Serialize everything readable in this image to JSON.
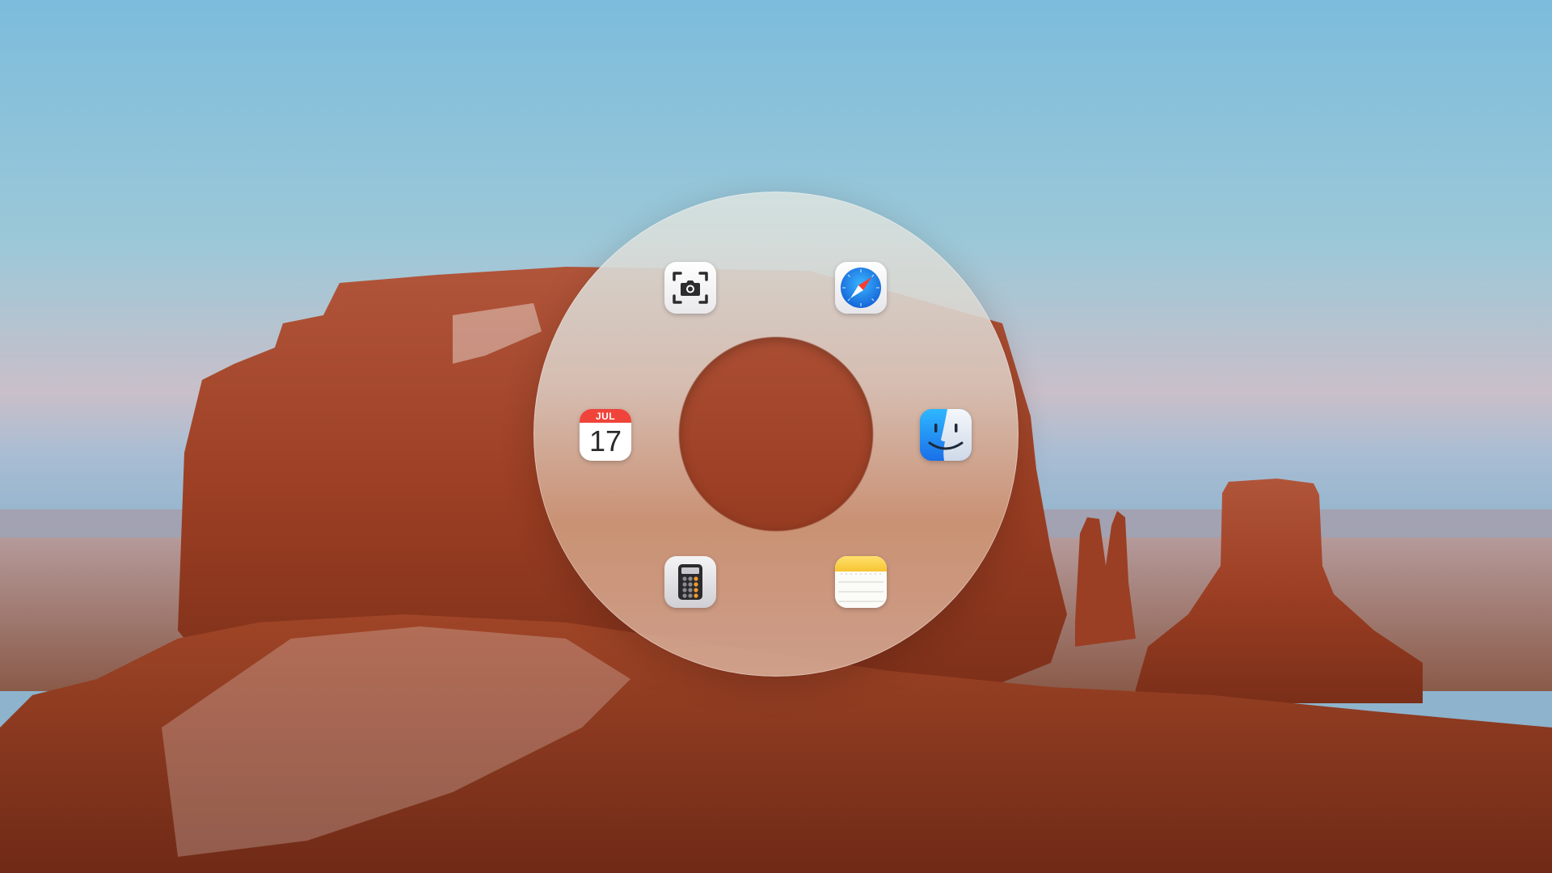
{
  "desktop": {
    "wallpaper": "desert-buttes-at-dusk",
    "sky_top_color": "#7fbddb",
    "sky_horizon_color": "#c8b9c4",
    "rock_color": "#a2462a"
  },
  "app_ring": {
    "apps": [
      {
        "id": "screenshot",
        "icon": "screenshot-icon"
      },
      {
        "id": "safari",
        "icon": "safari-compass-icon"
      },
      {
        "id": "calendar",
        "icon": "calendar-icon",
        "month": "JUL",
        "day": "17"
      },
      {
        "id": "finder",
        "icon": "finder-face-icon"
      },
      {
        "id": "calculator",
        "icon": "calculator-icon"
      },
      {
        "id": "notes",
        "icon": "notes-icon"
      }
    ],
    "accent_colors": {
      "calendar_header": "#f0443a",
      "safari_blue": "#1a82f0",
      "finder_blue": "#1e8cf0",
      "notes_yellow": "#fcd34b",
      "calculator_orange": "#f29a2e"
    }
  }
}
